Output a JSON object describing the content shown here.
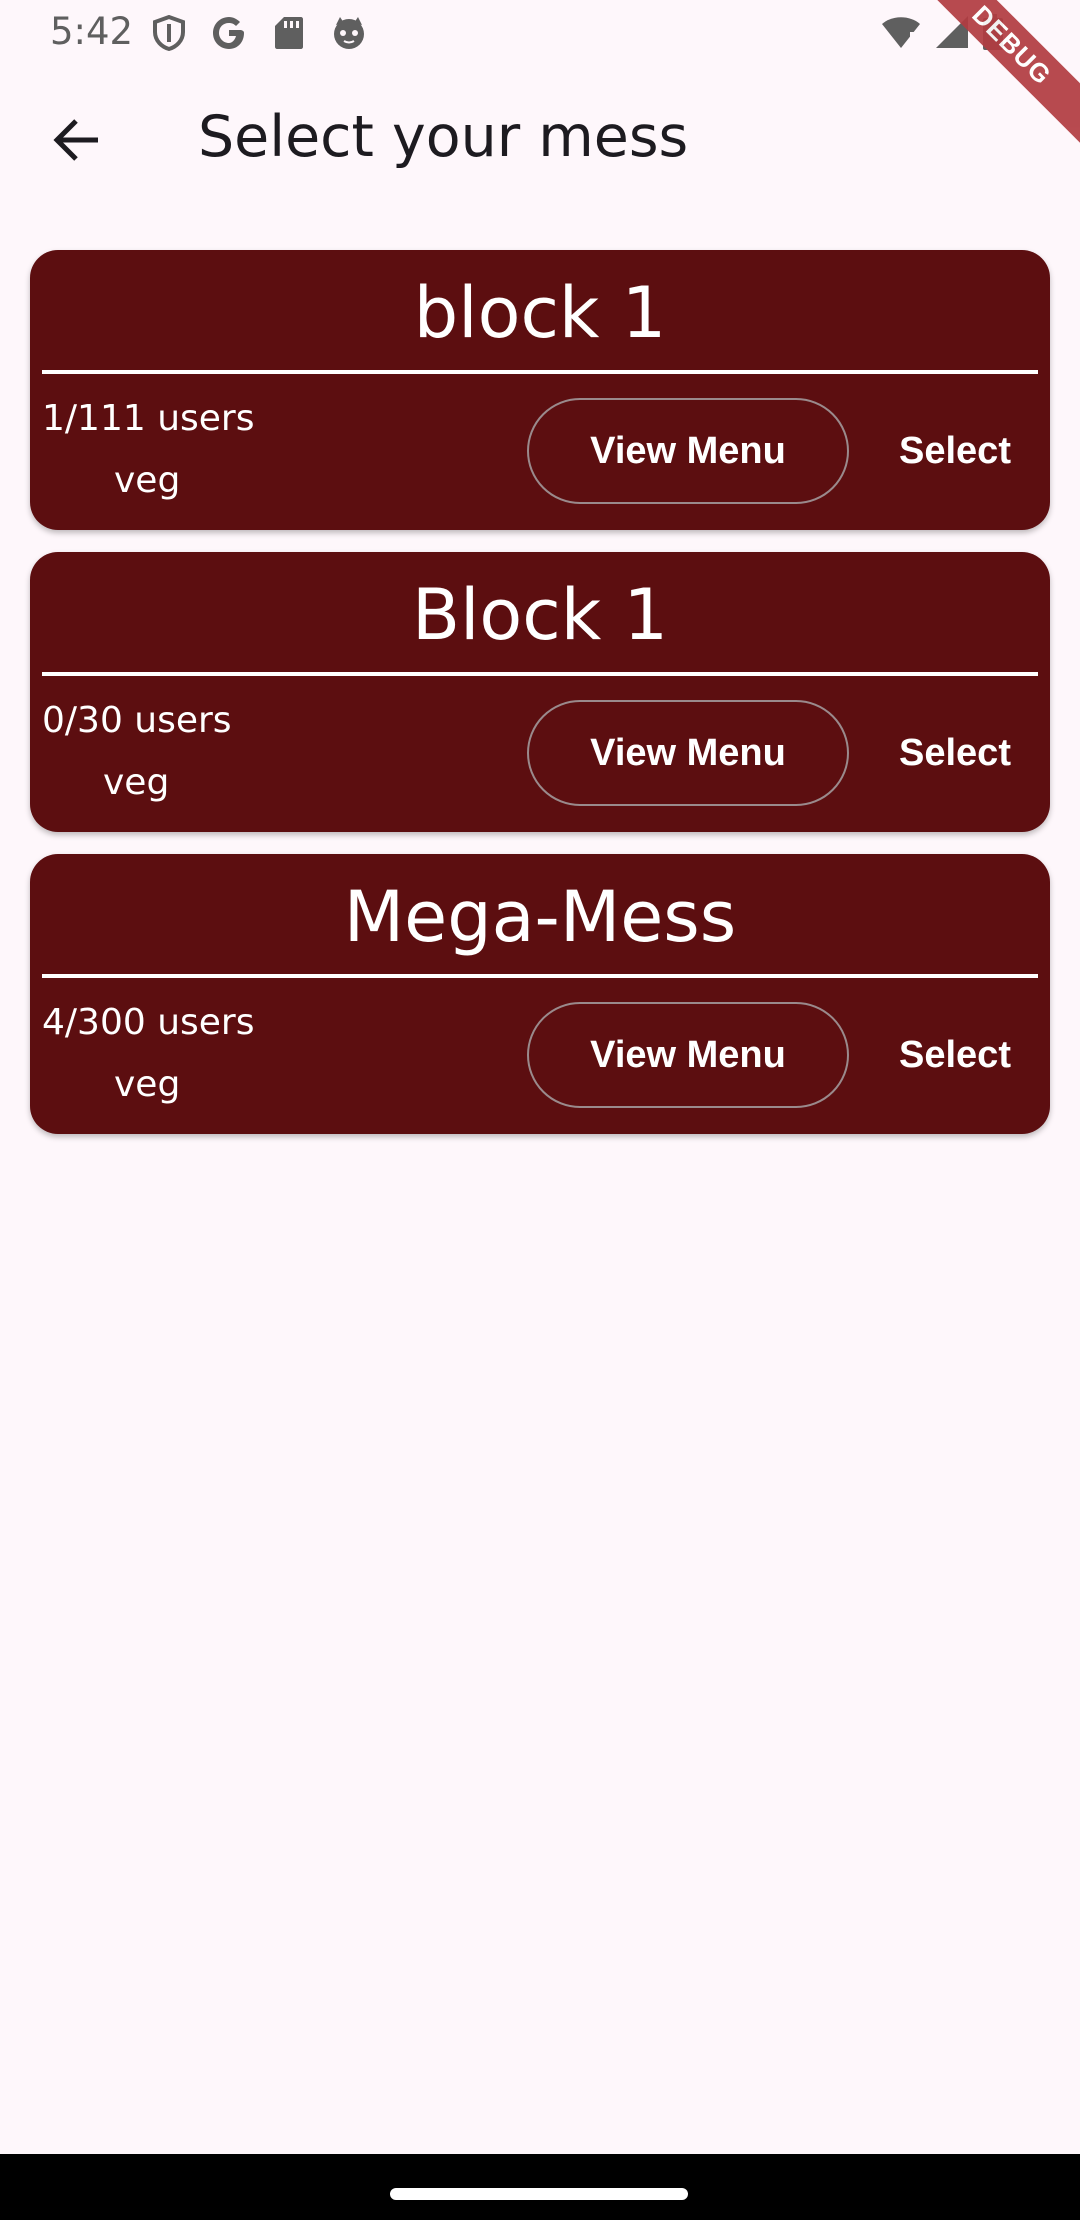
{
  "status_bar": {
    "time": "5:42",
    "left_icons": [
      "shield-icon",
      "google-icon",
      "sd-card-icon",
      "cat-face-icon"
    ],
    "right_icons": [
      "wifi-alert-icon",
      "signal-icon",
      "battery-icon"
    ],
    "debug_label": "DEBUG"
  },
  "app_bar": {
    "back_icon": "arrow-left-icon",
    "title": "Select your mess"
  },
  "messes": [
    {
      "name": "block 1",
      "users": "1/111 users",
      "type": "veg",
      "view_menu_label": "View Menu",
      "select_label": "Select"
    },
    {
      "name": "Block 1",
      "users": "0/30 users",
      "type": "veg",
      "view_menu_label": "View Menu",
      "select_label": "Select"
    },
    {
      "name": "Mega-Mess",
      "users": "4/300 users",
      "type": "veg",
      "view_menu_label": "View Menu",
      "select_label": "Select"
    }
  ],
  "colors": {
    "card_background": "#5C0E10",
    "page_background": "#FEF7FB",
    "text_on_card": "#FFFFFF",
    "debug_ribbon": "#B23C41"
  }
}
